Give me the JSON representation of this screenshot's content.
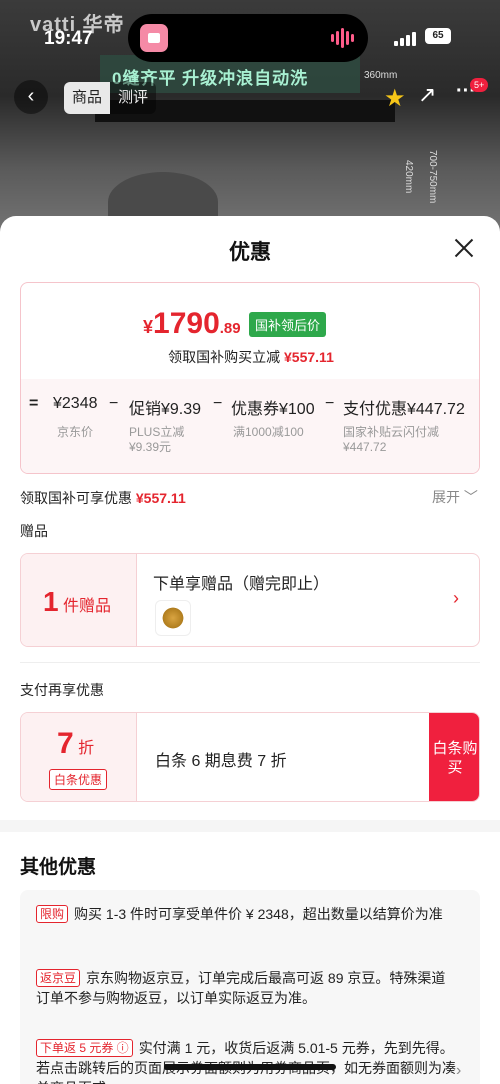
{
  "background": {
    "brand": "vatti 华帝",
    "banner": "0缝齐平 升级冲浪自动洗",
    "dims": [
      "360mm",
      "420mm",
      "700-750mm"
    ]
  },
  "status_bar": {
    "time": "19:47",
    "battery": "65"
  },
  "nav": {
    "back_icon": "chevron-left-icon",
    "tabs": [
      "商品",
      "测评"
    ],
    "badge": "5+"
  },
  "sheet": {
    "title": "优惠",
    "price": {
      "currency": "¥",
      "integer": "1790",
      "decimal": ".89",
      "tag": "国补领后价",
      "subsidy_line_prefix": "领取国补购买立减",
      "subsidy_amount": "¥557.11"
    },
    "calc": {
      "equals": "=",
      "jd_price": "¥2348",
      "jd_price_label": "京东价",
      "minus1": "−",
      "promo": "促销¥9.39",
      "promo_sub1": "PLUS立减",
      "promo_sub2": "¥9.39元",
      "minus2": "−",
      "coupon": "优惠券¥100",
      "coupon_sub": "满1000减100",
      "minus3": "−",
      "pay": "支付优惠¥447.72",
      "pay_sub1": "国家补贴云闪付减",
      "pay_sub2": "¥447.72"
    },
    "subsidy_summary": {
      "label": "领取国补可享优惠",
      "amount": "¥557.11",
      "expand": "展开 ﹀"
    },
    "gift_section": {
      "label": "赠品",
      "count": "1",
      "unit": "件赠品",
      "title": "下单享赠品（赠完即止）",
      "arrow": "›"
    },
    "payment_section": {
      "label": "支付再享优惠",
      "discount": "7",
      "discount_unit": "折",
      "badge": "白条优惠",
      "text": "白条 6 期息费 7 折",
      "buy_button": "白条购买"
    },
    "other": {
      "title": "其他优惠",
      "items": [
        {
          "tag": "限购",
          "text": "购买 1-3 件时可享受单件价 ¥ 2348，超出数量以结算价为准"
        },
        {
          "tag": "返京豆",
          "text": "京东购物返京豆，订单完成后最高可返 89 京豆。特殊渠道订单不参与购物返豆，以订单实际返豆为准。"
        },
        {
          "tag": "下单返 5 元券 ⓘ",
          "text": "实付满 1 元，收货后返满 5.01-5 元券，先到先得。若点击跳转后的页面展示券面额则为用券商品页，如无券面额则为凑单商品页或"
        }
      ],
      "arrow": "›"
    }
  },
  "colors": {
    "accent": "#e4252e",
    "green_tag": "#2ea84b",
    "buy_red": "#f0203e"
  }
}
